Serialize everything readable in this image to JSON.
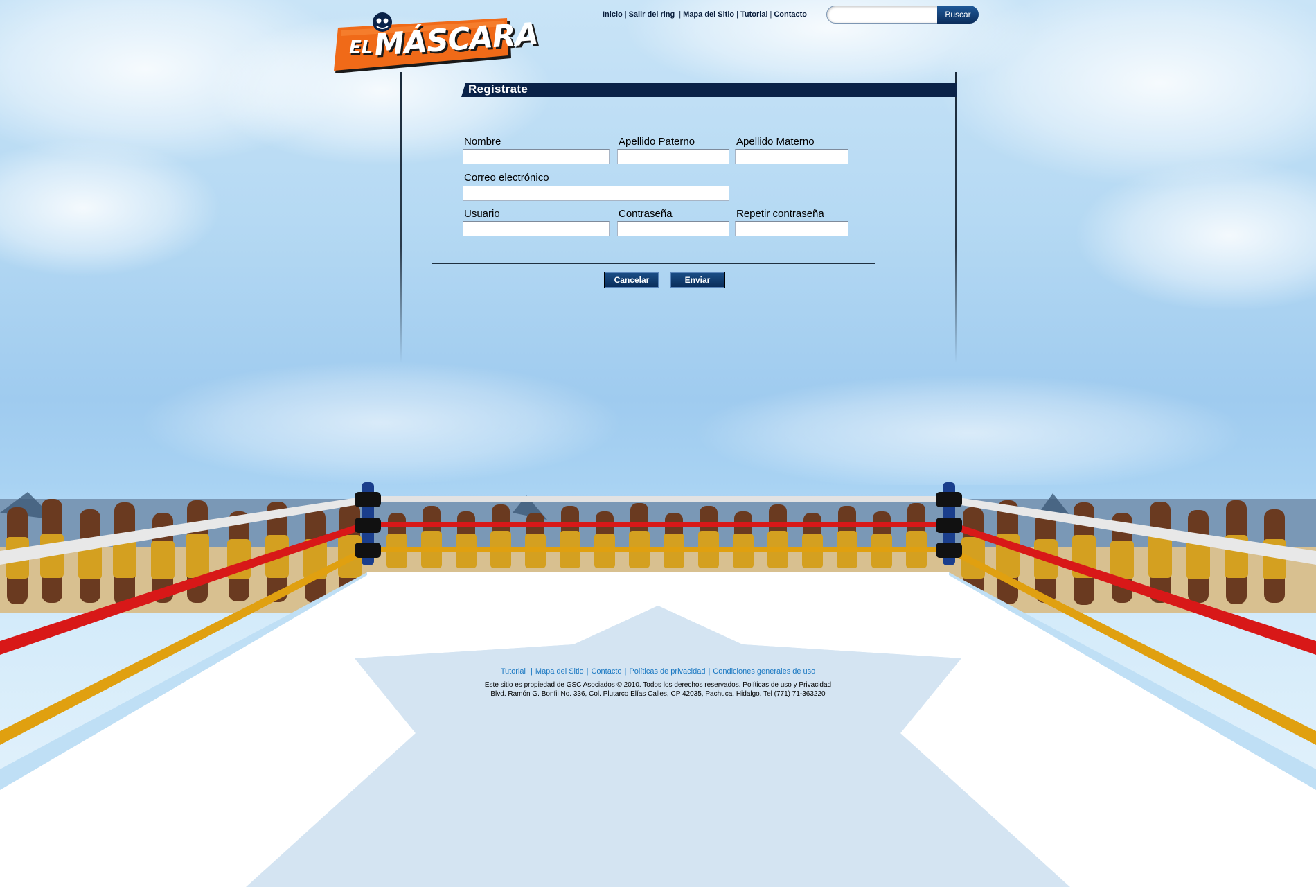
{
  "header": {
    "logo_text_small": "EL",
    "logo_text_big": "MÁSCARA",
    "nav": [
      "Inicio",
      "Salir del ring",
      "Mapa del Sitio",
      "Tutorial",
      "Contacto"
    ],
    "search_placeholder": "",
    "search_button": "Buscar"
  },
  "form": {
    "title": "Regístrate",
    "fields": {
      "nombre": {
        "label": "Nombre",
        "value": ""
      },
      "apellido_paterno": {
        "label": "Apellido Paterno",
        "value": ""
      },
      "apellido_materno": {
        "label": "Apellido Materno",
        "value": ""
      },
      "correo": {
        "label": "Correo electrónico",
        "value": ""
      },
      "usuario": {
        "label": "Usuario",
        "value": ""
      },
      "contrasena": {
        "label": "Contraseña",
        "value": ""
      },
      "repetir_contrasena": {
        "label": "Repetir contraseña",
        "value": ""
      }
    },
    "cancel_button": "Cancelar",
    "submit_button": "Enviar"
  },
  "footer": {
    "links": [
      "Tutorial",
      "Mapa del Sitio",
      "Contacto",
      "Políticas de privacidad",
      "Condiciones generales de uso"
    ],
    "copyright": "Este sitio es propiedad de GSC Asociados © 2010. Todos los derechos reservados. Políticas de uso y Privacidad",
    "address": "Blvd. Ramón G. Bonfil No. 336, Col. Plutarco Elías Calles, CP 42035, Pachuca, Hidalgo. Tel (771) 71-363220"
  },
  "colors": {
    "navy": "#0a2248",
    "logo_orange": "#f06a18",
    "rope_white": "#e8e8e8",
    "rope_red": "#d81818",
    "rope_yellow": "#e0a010",
    "star": "#d4e4f2"
  }
}
